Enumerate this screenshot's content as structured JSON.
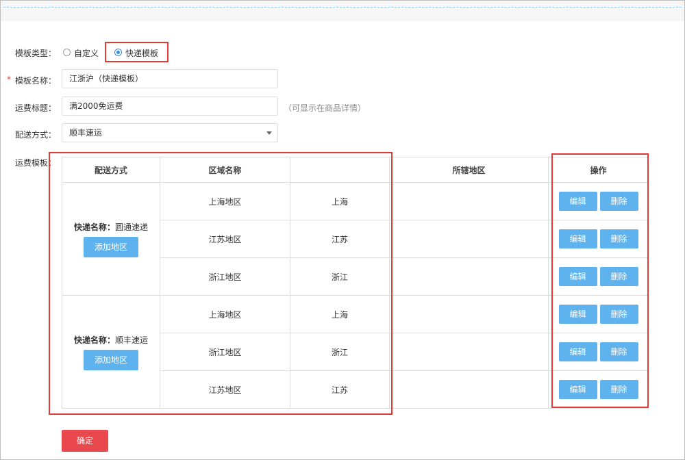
{
  "form": {
    "template_type_label": "模板类型：",
    "template_type_options": [
      "自定义",
      "快递模板"
    ],
    "required_mark": "*",
    "template_name_label": "模板名称：",
    "template_name_value": "江浙沪（快递模板）",
    "shipping_title_label": "运费标题：",
    "shipping_title_value": "满2000免运费",
    "shipping_title_hint": "（可显示在商品详情）",
    "delivery_method_label": "配送方式：",
    "delivery_method_value": "顺丰速运",
    "freight_template_label": "运费模板："
  },
  "table": {
    "headers": [
      "配送方式",
      "区域名称",
      "",
      "所辖地区",
      "操作"
    ],
    "groups": [
      {
        "method_label": "快递名称：",
        "method_name": "圆通速递",
        "add_button": "添加地区",
        "rows": [
          {
            "area": "上海地区",
            "region": "上海"
          },
          {
            "area": "江苏地区",
            "region": "江苏"
          },
          {
            "area": "浙江地区",
            "region": "浙江"
          }
        ]
      },
      {
        "method_label": "快递名称：",
        "method_name": "顺丰速运",
        "add_button": "添加地区",
        "rows": [
          {
            "area": "上海地区",
            "region": "上海"
          },
          {
            "area": "浙江地区",
            "region": "浙江"
          },
          {
            "area": "江苏地区",
            "region": "江苏"
          }
        ]
      }
    ],
    "edit_label": "编辑",
    "delete_label": "删除"
  },
  "confirm_label": "确定",
  "colors": {
    "accent_blue": "#5eb2ee",
    "highlight_red": "#e53935",
    "confirm_red": "#e9484d"
  }
}
